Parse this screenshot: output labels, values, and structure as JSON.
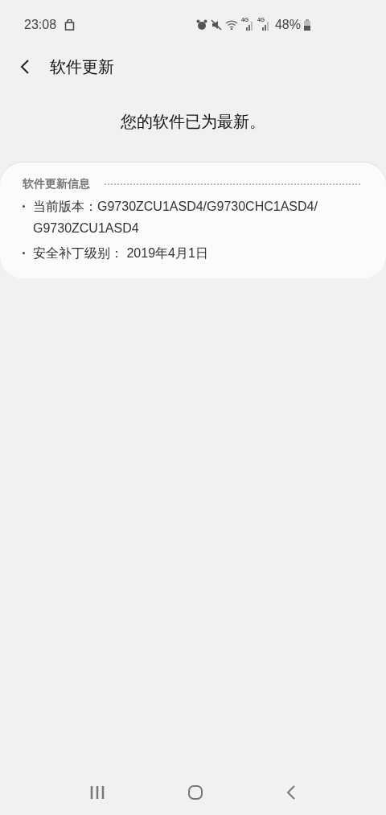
{
  "status_bar": {
    "time": "23:08",
    "network_labels": [
      "4G",
      "4G"
    ],
    "battery": "48%"
  },
  "header": {
    "title": "软件更新"
  },
  "message": "您的软件已为最新。",
  "info_card": {
    "title": "软件更新信息",
    "items": [
      {
        "label": "当前版本：",
        "value": "G9730ZCU1ASD4/G9730CHC1ASD4/ G9730ZCU1ASD4"
      },
      {
        "label": "安全补丁级别：",
        "value": " 2019年4月1日"
      }
    ]
  }
}
